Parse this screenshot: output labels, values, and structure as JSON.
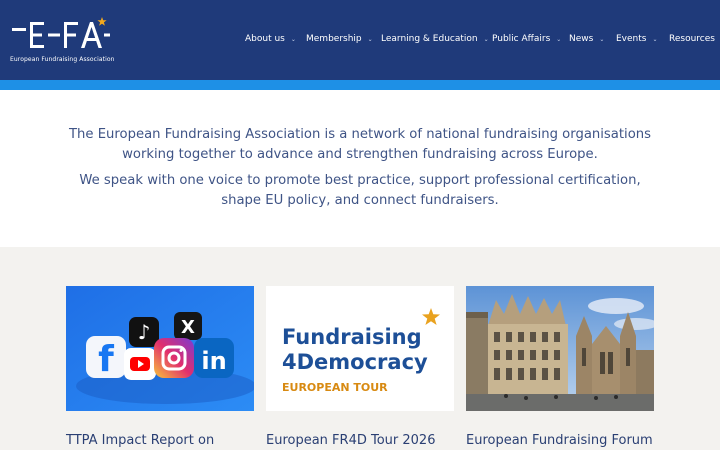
{
  "brand": {
    "logo_text": "EFA",
    "tagline": "European Fundraising Association",
    "colors": {
      "header": "#1f3a7a",
      "stripe": "#1e90e6",
      "accent_star": "#f2a81d"
    }
  },
  "nav": {
    "items": [
      {
        "label": "About us",
        "has_menu": true
      },
      {
        "label": "Membership",
        "has_menu": true
      },
      {
        "label": "Learning & Education",
        "has_menu": true
      },
      {
        "label": "Public Affairs",
        "has_menu": true
      },
      {
        "label": "News",
        "has_menu": true
      },
      {
        "label": "Events",
        "has_menu": true
      },
      {
        "label": "Resources",
        "has_menu": false
      }
    ],
    "chevron_glyph": "⌄"
  },
  "intro": {
    "paragraph_1": "The European Fundraising Association is a network of national fundraising organisations working together to advance and strengthen fundraising across Europe.",
    "paragraph_2": "We speak with one voice to promote best practice, support professional certification, shape EU policy, and connect fundraisers."
  },
  "cards": [
    {
      "title": "TTPA Impact Report on",
      "image": "social-media-icons-image"
    },
    {
      "title": "European FR4D Tour 2026",
      "image": "fundraising-4democracy-image",
      "image_text": {
        "line1": "Fundraising",
        "line2": "4Democracy",
        "line3": "EUROPEAN TOUR"
      }
    },
    {
      "title": "European Fundraising Forum",
      "image": "old-town-hall-image"
    }
  ]
}
